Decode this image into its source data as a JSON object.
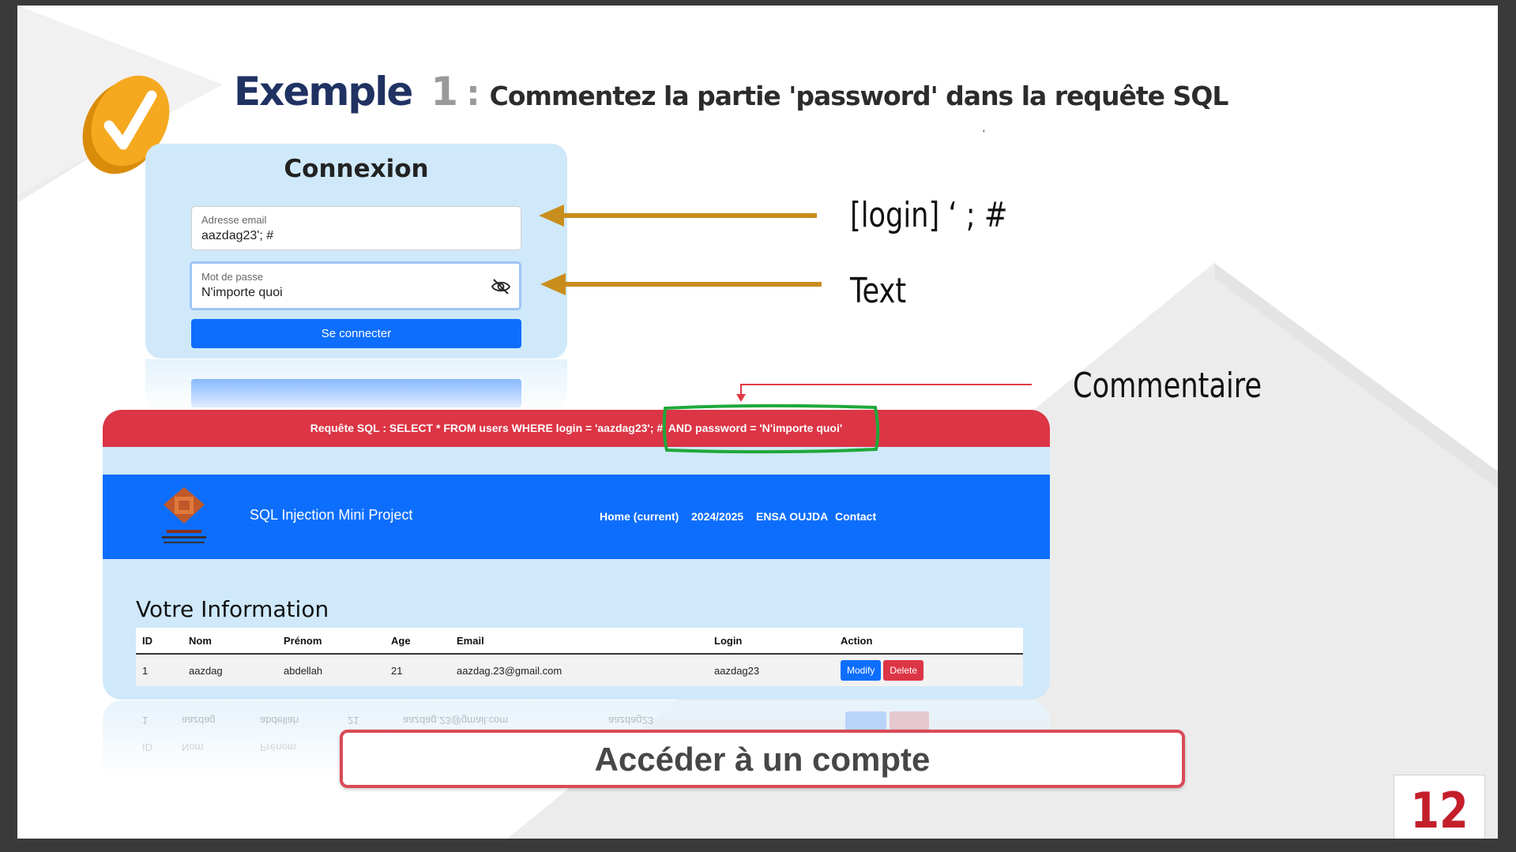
{
  "title": {
    "main": "Exemple",
    "number": "1",
    "separator": ":",
    "subtitle": "Commentez la partie 'password' dans la requête SQL"
  },
  "login_form": {
    "heading": "Connexion",
    "email_label": "Adresse email",
    "email_value": "aazdag23'; #",
    "password_label": "Mot de passe",
    "password_value": "N'importe quoi",
    "submit_label": "Se connecter"
  },
  "annotations": {
    "login_hint": "[login] ‘ ; #",
    "text_hint": "Text",
    "comment_hint": "Commentaire"
  },
  "result": {
    "sql_query": "Requête SQL : SELECT * FROM users WHERE login = 'aazdag23'; #' AND password = 'N'importe quoi'",
    "brand_name": "SQL Injection Mini Project",
    "nav_links": [
      "Home (current)",
      "2024/2025",
      "ENSA OUJDA",
      "Contact"
    ],
    "section_title": "Votre Information",
    "table_headers": [
      "ID",
      "Nom",
      "Prénom",
      "Age",
      "Email",
      "Login",
      "Action"
    ],
    "rows": [
      {
        "id": "1",
        "nom": "aazdag",
        "prenom": "abdellah",
        "age": "21",
        "email": "aazdag.23@gmail.com",
        "login": "aazdag23",
        "modify_label": "Modify",
        "delete_label": "Delete"
      }
    ]
  },
  "banner": "Accéder à un compte",
  "page_number": "12",
  "colors": {
    "accent_blue": "#0d6efd",
    "danger_red": "#dc3545",
    "arrow_gold": "#c98d1c",
    "highlight_green": "#1fa83a",
    "title_navy": "#1f3262"
  }
}
